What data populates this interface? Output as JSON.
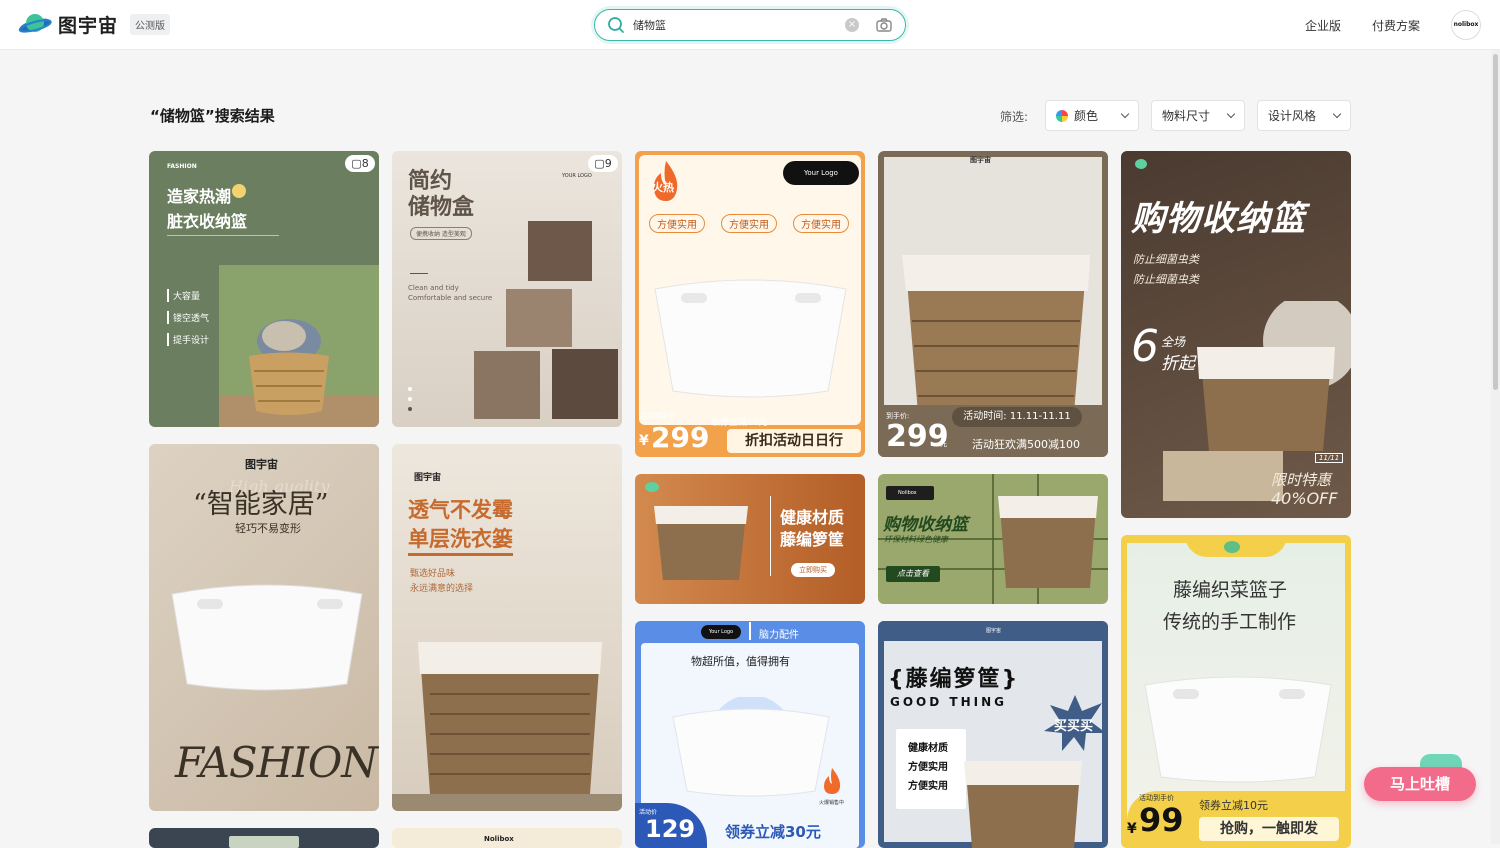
{
  "header": {
    "logo_name": "图宇宙",
    "logo_badge": "公测版",
    "search_value": "储物篮",
    "nav": [
      "企业版",
      "付费方案"
    ],
    "avatar_text": "nolibox"
  },
  "results": {
    "title": "“储物篮”搜索结果",
    "filter_label": "筛选:",
    "filters": [
      "颜色",
      "物料尺寸",
      "设计风格"
    ]
  },
  "cards": {
    "c1": {
      "brand": "FASHION",
      "title1": "造家热潮",
      "title2": "脏衣收纳篮",
      "features": [
        "大容量",
        "镂空透气",
        "提手设计"
      ],
      "count": "8"
    },
    "c2": {
      "title1": "简约",
      "title2": "储物盒",
      "sub": "便携收纳 造型美观",
      "logo": "YOUR LOGO",
      "en1": "Clean and tidy",
      "en2": "Comfortable and secure",
      "count": "9"
    },
    "c3": {
      "fire": "火热",
      "logo": "Your Logo",
      "tags": [
        "方便实用",
        "方便实用",
        "方便实用"
      ],
      "price_label": "活动到手价",
      "currency": "¥",
      "price": "299",
      "coupon": "领券立减10元",
      "banner": "折扣活动日日行"
    },
    "c4": {
      "brand": "图宇宙",
      "price_label": "到手价:",
      "price": "299",
      "unit": "元",
      "time": "活动时间: 11.11-11.11",
      "promo": "活动狂欢满500减100"
    },
    "c5": {
      "title": "购物收纳篮",
      "sub1": "防止细菌虫类",
      "sub2": "防止细菌虫类",
      "discount_num": "6",
      "discount_a": "全场",
      "discount_b": "折起",
      "date": "11/11",
      "limit1": "限时特惠",
      "limit2": "40%OFF"
    },
    "c6": {
      "brand": "图宇宙",
      "script": "High quality",
      "title": "“智能家居”",
      "sub": "轻巧不易变形",
      "bottom": "FASHION"
    },
    "c7": {
      "brand": "图宇宙",
      "title1": "透气不发霉",
      "title2": "单层洗衣篓",
      "sub1": "甄选好品味",
      "sub2": "永远满意的选择"
    },
    "c8": {
      "title1": "健康材质",
      "title2": "藤编箩筐",
      "button": "立即购买"
    },
    "c9": {
      "logo": "Nolibox",
      "title": "购物收纳篮",
      "sub": "环保材料绿色健康",
      "button": "点击查看"
    },
    "c10": {
      "logo": "Your Logo",
      "category": "脑力配件",
      "slogan": "物超所值，值得拥有",
      "hot": "火爆销售中",
      "price_label": "活动价",
      "price": "129",
      "coupon": "领券立减30元"
    },
    "c11": {
      "brand": "图宇宙",
      "title": "{藤编箩筐}",
      "en": "GOOD THING",
      "burst": "买买买",
      "features": [
        "健康材质",
        "方便实用",
        "方便实用"
      ]
    },
    "c12": {
      "title1": "藤编织菜篮子",
      "title2": "传统的手工制作",
      "price_label": "活动到手价",
      "currency": "¥",
      "price": "99",
      "coupon": "领券立减10元",
      "banner": "抢购，一触即发"
    },
    "c13": {
      "logo": "Nolibox"
    }
  },
  "feedback_label": "马上吐槽",
  "colors": {
    "accent": "#3ab8a8",
    "feedback": "#f26b8a"
  }
}
